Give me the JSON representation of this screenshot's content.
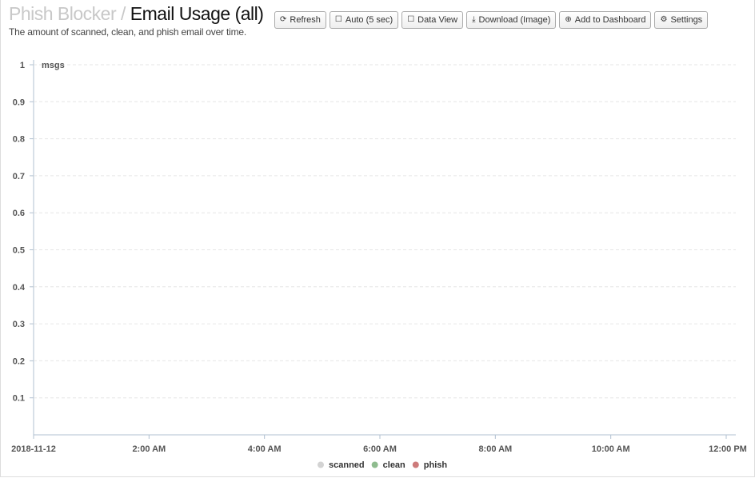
{
  "header": {
    "app": "Phish Blocker",
    "separator": "/",
    "title": "Email Usage (all)",
    "subtitle": "The amount of scanned, clean, and phish email over time."
  },
  "toolbar": [
    {
      "label": "Refresh",
      "icon": "refresh-icon",
      "glyph": "⟳"
    },
    {
      "label": "Auto (5 sec)",
      "icon": "checkbox-icon",
      "glyph": "☐"
    },
    {
      "label": "Data View",
      "icon": "checkbox-icon",
      "glyph": "☐"
    },
    {
      "label": "Download (Image)",
      "icon": "download-icon",
      "glyph": "⤓"
    },
    {
      "label": "Add to Dashboard",
      "icon": "plus-circle-icon",
      "glyph": "⊕"
    },
    {
      "label": "Settings",
      "icon": "gear-icon",
      "glyph": "⚙"
    }
  ],
  "chart_data": {
    "type": "line",
    "ylabel": "msgs",
    "ylim": [
      0,
      1
    ],
    "yticks": [
      "0.1",
      "0.2",
      "0.3",
      "0.4",
      "0.5",
      "0.6",
      "0.7",
      "0.8",
      "0.9",
      "1"
    ],
    "xticks": [
      "2018-11-12",
      "2:00 AM",
      "4:00 AM",
      "6:00 AM",
      "8:00 AM",
      "10:00 AM",
      "12:00 PM"
    ],
    "grid": true,
    "legend_position": "bottom",
    "series": [
      {
        "name": "scanned",
        "color": "#d3d3d3",
        "values": []
      },
      {
        "name": "clean",
        "color": "#8fbc8f",
        "values": []
      },
      {
        "name": "phish",
        "color": "#cd7b7b",
        "values": []
      }
    ]
  }
}
